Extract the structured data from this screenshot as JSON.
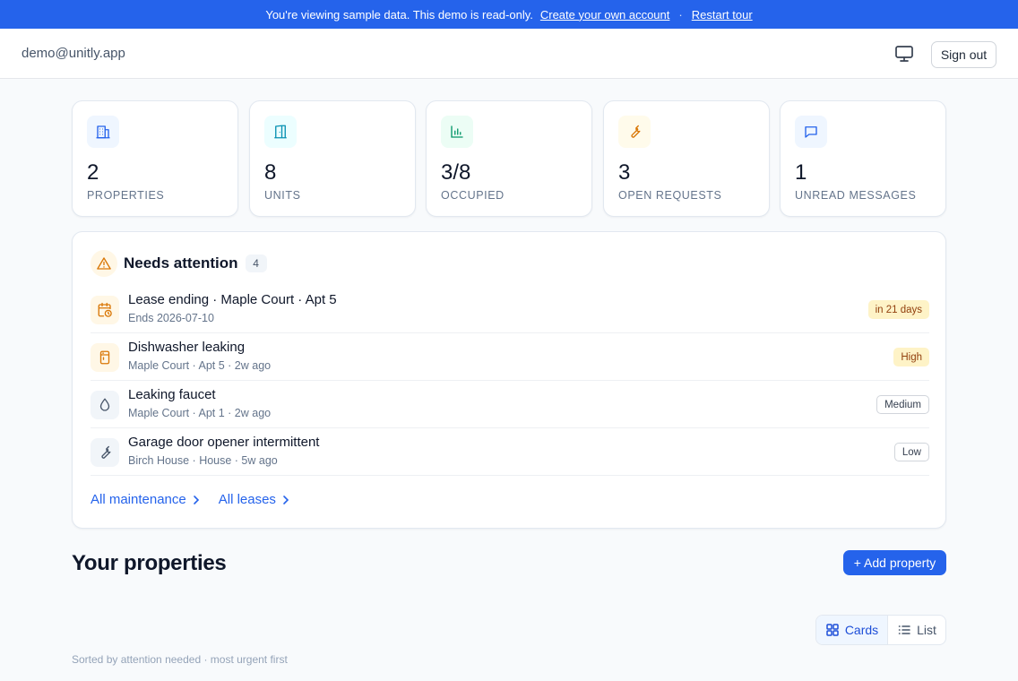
{
  "banner": {
    "message": "You're viewing sample data. This demo is read-only.",
    "create_link": "Create your own account",
    "separator": "·",
    "restart_link": "Restart tour",
    "bg_color": "#2563eb"
  },
  "header": {
    "email": "demo@unitly.app",
    "display_icon": "monitor-icon",
    "sign_out": "Sign out"
  },
  "stats": [
    {
      "value": "2",
      "label": "Properties",
      "icon": "building-icon",
      "color": "#2563eb",
      "bg": "#eff6ff"
    },
    {
      "value": "8",
      "label": "Units",
      "icon": "door-icon",
      "color": "#0891b2",
      "bg": "#ecfeff"
    },
    {
      "value": "3/8",
      "label": "Occupied",
      "icon": "bar-chart-icon",
      "color": "#059669",
      "bg": "#ecfdf5"
    },
    {
      "value": "3",
      "label": "Open requests",
      "icon": "wrench-icon",
      "color": "#d97706",
      "bg": "#fffbeb"
    },
    {
      "value": "1",
      "label": "Unread messages",
      "icon": "message-icon",
      "color": "#2563eb",
      "bg": "#eff6ff"
    }
  ],
  "attention": {
    "title": "Needs attention",
    "count": "4",
    "items": [
      {
        "title": "Lease ending · Maple Court · Apt 5",
        "subtitle": "Ends 2026-07-10",
        "badge": "in 21 days",
        "icon": "calendar-clock-icon"
      },
      {
        "title": "Dishwasher leaking",
        "subtitle": "Maple Court · Apt 5 · 2w ago",
        "badge": "High",
        "icon": "appliance-icon"
      },
      {
        "title": "Leaking faucet",
        "subtitle": "Maple Court · Apt 1 · 2w ago",
        "badge": "Medium",
        "icon": "droplet-icon"
      },
      {
        "title": "Garage door opener intermittent",
        "subtitle": "Birch House · House · 5w ago",
        "badge": "Low",
        "icon": "wrench-icon"
      }
    ],
    "links": {
      "maintenance": "All maintenance",
      "leases": "All leases"
    }
  },
  "properties": {
    "title": "Your properties",
    "add_button": "+ Add property",
    "view_options": [
      "Cards",
      "List"
    ],
    "selected_view": "Cards",
    "sort_note": "Sorted by attention needed · most urgent first"
  }
}
